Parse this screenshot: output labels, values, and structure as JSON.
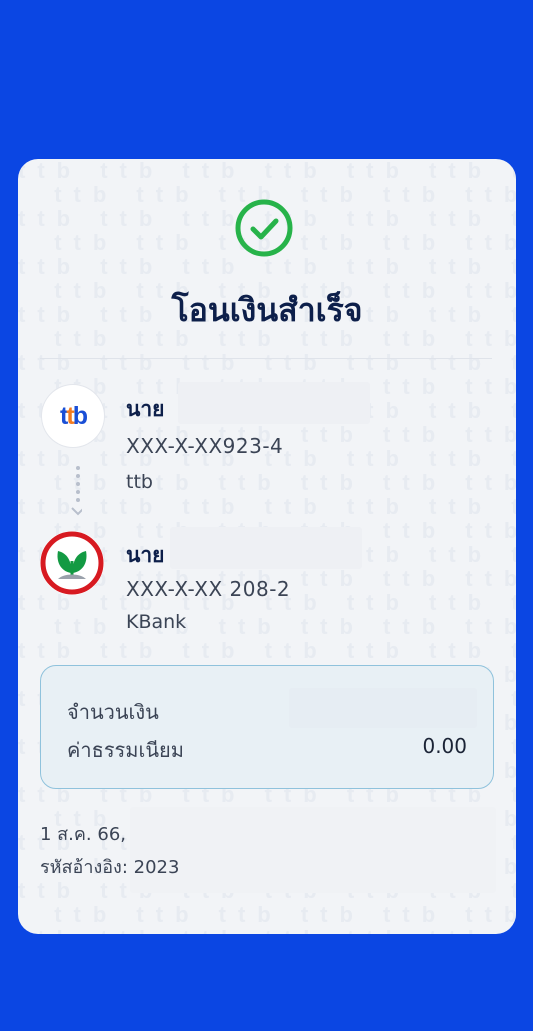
{
  "status": {
    "title": "โอนเงินสำเร็จ",
    "icon": "check-circle-icon",
    "color": "#27b34a"
  },
  "watermark_text": "ttb",
  "sender": {
    "name_prefix": "นาย",
    "account": "XXX-X-XX923-4",
    "bank": "ttb",
    "logo": "ttb-logo"
  },
  "receiver": {
    "name_prefix": "นาย",
    "account": "XXX-X-XX 208-2",
    "bank": "KBank",
    "logo": "kbank-logo"
  },
  "amount": {
    "label": "จำนวนเงิน",
    "fee_label": "ค่าธรรมเนียม",
    "fee_value": "0.00"
  },
  "footer": {
    "date": "1 ส.ค. 66,",
    "reference": "รหัสอ้างอิง: 2023"
  },
  "colors": {
    "background": "#0b46e3",
    "title": "#0d1f4a",
    "kbank_red": "#d71a21",
    "kbank_green": "#139a43",
    "ttb_blue": "#1a4fd6",
    "ttb_orange": "#f47b20"
  }
}
